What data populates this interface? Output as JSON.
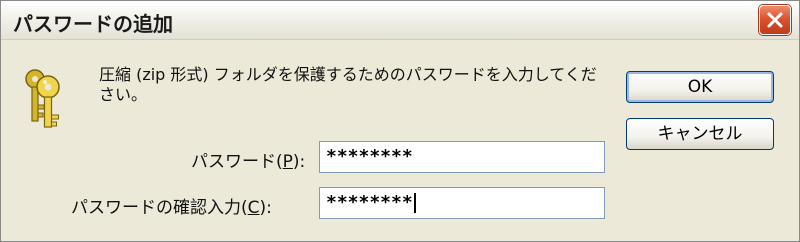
{
  "window": {
    "title": "パスワードの追加"
  },
  "message": "圧縮 (zip 形式) フォルダを保護するためのパスワードを入力してください。",
  "fields": {
    "password": {
      "label_before": "パスワード(",
      "mnemonic": "P",
      "label_after": "):",
      "value": "********"
    },
    "confirm": {
      "label_before": "パスワードの確認入力(",
      "mnemonic": "C",
      "label_after": "):",
      "value": "********"
    }
  },
  "buttons": {
    "ok": "OK",
    "cancel": "キャンセル"
  },
  "icons": {
    "close": "close-icon",
    "key": "key-icon"
  },
  "colors": {
    "close_button": "#d8502c",
    "dialog_bg": "#ece9d8",
    "key_gold": "#e8c840"
  }
}
